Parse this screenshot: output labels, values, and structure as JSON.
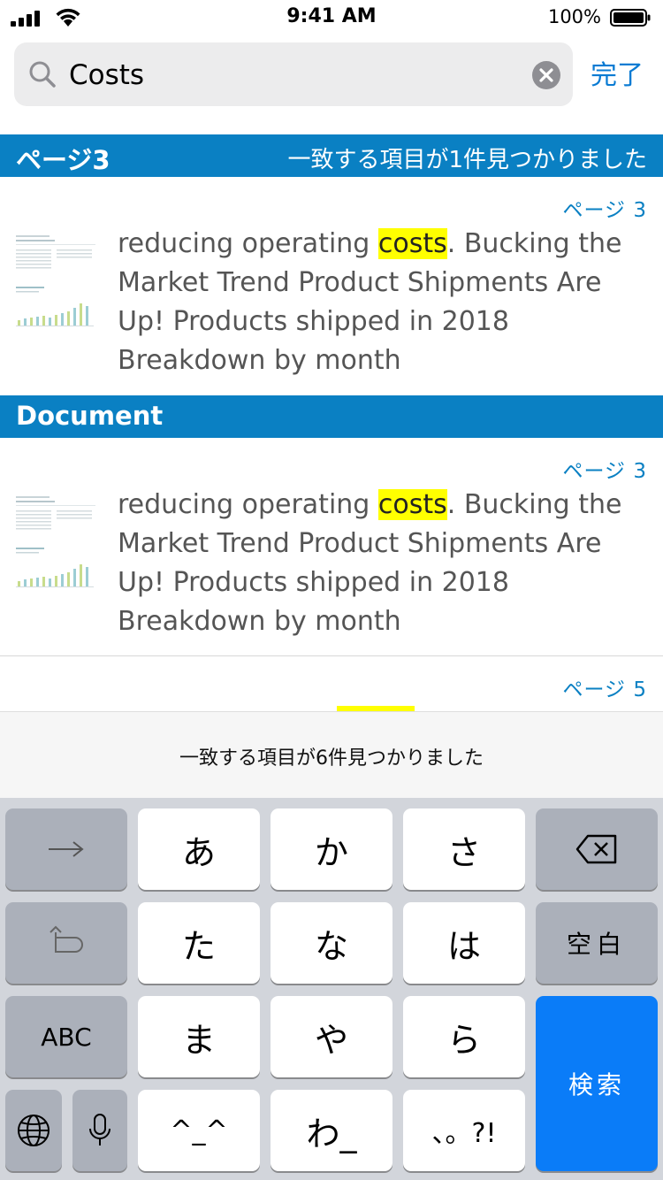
{
  "status_bar": {
    "time": "9:41 AM",
    "battery_percent": "100%"
  },
  "search": {
    "query": "Costs",
    "done_label": "完了"
  },
  "sections": [
    {
      "title": "ページ3",
      "match_count_text": "一致する項目が1件見つかりました"
    },
    {
      "title": "Document"
    }
  ],
  "results": [
    {
      "page_label": "ページ 3",
      "text_before": "reducing operating ",
      "highlight": "costs",
      "text_after": ". Bucking the Market Trend Product Shipments Are Up! Products shipped in 2018 Breakdown by month"
    },
    {
      "page_label": "ページ 3",
      "text_before": "reducing operating ",
      "highlight": "costs",
      "text_after": ". Bucking the Market Trend Product Shipments Are Up! Products shipped in 2018 Breakdown by month"
    },
    {
      "page_label": "ページ 5"
    }
  ],
  "match_summary": "一致する項目が6件見つかりました",
  "keyboard": {
    "keys": {
      "next": "→",
      "a": "あ",
      "ka": "か",
      "sa": "さ",
      "undo": "↺",
      "ta": "た",
      "na": "な",
      "ha": "は",
      "space": "空白",
      "abc": "ABC",
      "ma": "ま",
      "ya": "や",
      "ra": "ら",
      "search": "検索",
      "emoticon": "^_^",
      "wa": "わ_",
      "punct": "、。?!"
    }
  },
  "colors": {
    "accent": "#0a80c3",
    "link": "#0a7bd3",
    "highlight": "#ffff00",
    "search_key": "#0a7cf8"
  }
}
